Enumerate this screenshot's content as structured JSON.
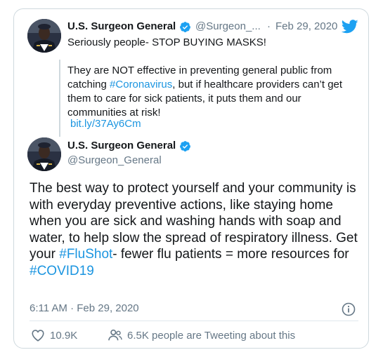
{
  "quoted_tweet": {
    "author_name": "U.S. Surgeon General",
    "author_handle": "@Surgeon_...",
    "date_separator": "·",
    "date": "Feb 29, 2020",
    "line1": "Seriously people- STOP BUYING MASKS!",
    "body_before_hashtag": "They are NOT effective in preventing general public from catching ",
    "hashtag": "#Coronavirus",
    "body_after_hashtag": ", but if healthcare providers can’t get them to care for sick patients, it puts them and our communities at risk!",
    "link": "bit.ly/37Ay6Cm"
  },
  "main_tweet": {
    "author_name": "U.S. Surgeon General",
    "author_handle": "@Surgeon_General",
    "body_part1": "The best way to protect yourself and your community is with everyday preventive actions, like staying home when you are sick and washing hands with soap and water, to help slow the spread of respiratory illness. Get your ",
    "hashtag1": "#FluShot",
    "body_part2": "- fewer flu patients = more resources for",
    "hashtag2": "#COVID19",
    "timestamp": "6:11 AM · Feb 29, 2020"
  },
  "actions": {
    "like_count": "10.9K",
    "retweet_text": "6.5K people are Tweeting about this"
  },
  "icons": {
    "verified": "verified-badge-icon",
    "bird": "twitter-bird-icon",
    "info": "info-icon",
    "heart": "heart-icon",
    "people": "people-icon"
  },
  "colors": {
    "link": "#1b95e0",
    "verified": "#1da1f2",
    "muted": "#657786",
    "text": "#14171a"
  }
}
